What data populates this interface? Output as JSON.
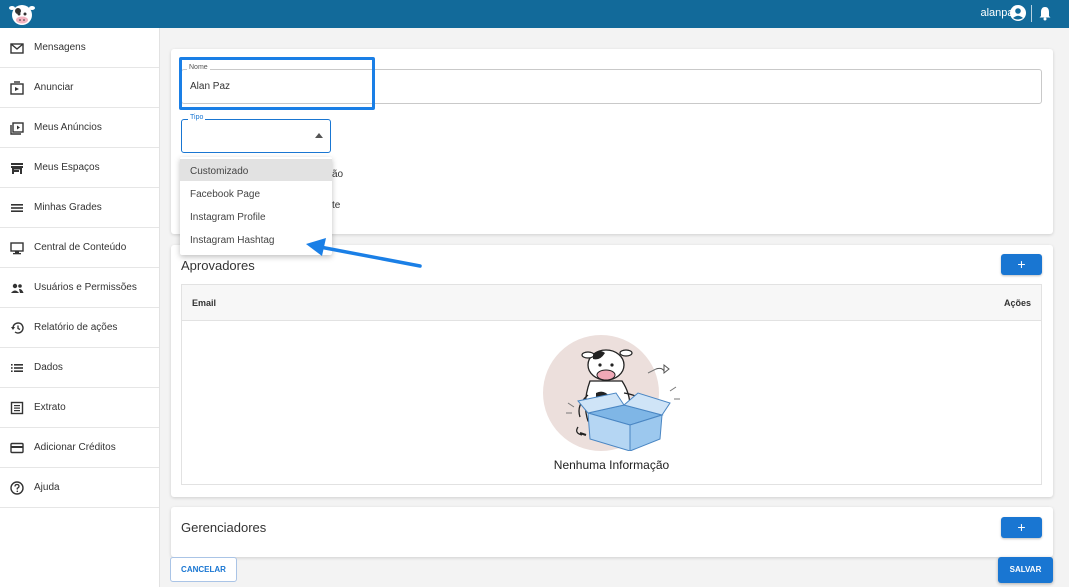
{
  "topbar": {
    "username": "alanpaz",
    "user_icon": "account-circle-icon",
    "bell_icon": "bell-icon",
    "logo": "cow-logo"
  },
  "sidebar": {
    "items": [
      {
        "label": "Mensagens",
        "icon": "mail-icon"
      },
      {
        "label": "Anunciar",
        "icon": "play-box-icon"
      },
      {
        "label": "Meus Anúncios",
        "icon": "play-stack-icon"
      },
      {
        "label": "Meus Espaços",
        "icon": "store-icon"
      },
      {
        "label": "Minhas Grades",
        "icon": "menu-lines-icon"
      },
      {
        "label": "Central de Conteúdo",
        "icon": "monitor-icon"
      },
      {
        "label": "Usuários e Permissões",
        "icon": "people-icon"
      },
      {
        "label": "Relatório de ações",
        "icon": "history-icon"
      },
      {
        "label": "Dados",
        "icon": "list-icon"
      },
      {
        "label": "Extrato",
        "icon": "receipt-icon"
      },
      {
        "label": "Adicionar Créditos",
        "icon": "credit-card-icon"
      },
      {
        "label": "Ajuda",
        "icon": "help-circle-icon"
      }
    ]
  },
  "form": {
    "nome": {
      "legend": "Nome",
      "value": "Alan Paz"
    },
    "tipo": {
      "legend": "Tipo",
      "value": ""
    },
    "partial_behind_1": "ão",
    "partial_behind_2": "te"
  },
  "dropdown": {
    "options": [
      "Customizado",
      "Facebook Page",
      "Instagram Profile",
      "Instagram Hashtag"
    ],
    "selected": "Customizado"
  },
  "approvers": {
    "title": "Aprovadores",
    "add_label": "+",
    "columns": [
      "Email",
      "Ações"
    ],
    "empty_text": "Nenhuma Informação"
  },
  "managers": {
    "title": "Gerenciadores",
    "add_label": "+"
  },
  "footer": {
    "cancel_label": "CANCELAR",
    "save_label": "SALVAR"
  },
  "colors": {
    "topbar": "#126a9a",
    "primary": "#1976d2",
    "highlight": "#1a7fe6"
  }
}
